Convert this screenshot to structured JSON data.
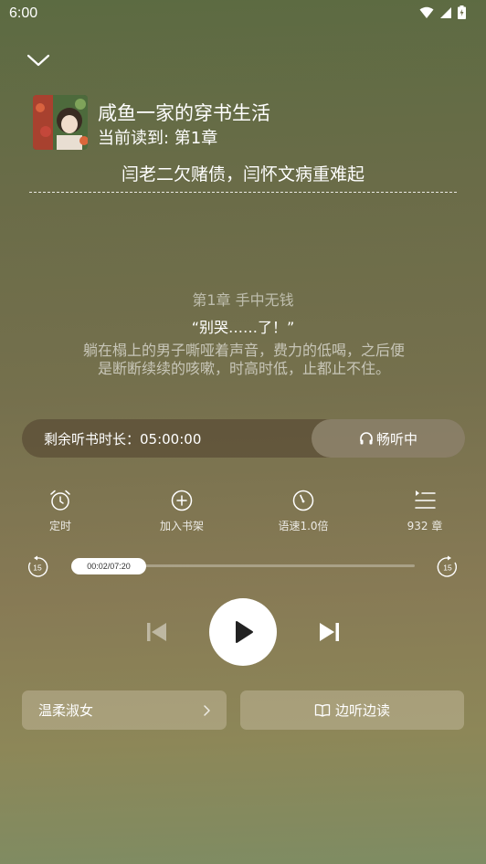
{
  "status_bar": {
    "time": "6:00"
  },
  "book": {
    "title": "咸鱼一家的穿书生活",
    "current_reading": "当前读到: 第1章",
    "chapter_heading": "闫老二欠赌债，闫怀文病重难起"
  },
  "preview": {
    "chapter": "第1章 手中无钱",
    "quote": "“别哭……了！”",
    "body": "躺在榻上的男子嘶哑着声音，费力的低喝，之后便是断断续续的咳嗽，时高时低，止都止不住。"
  },
  "remaining": {
    "label": "剩余听书时长：05:00:00",
    "listen_label": "畅听中"
  },
  "functions": [
    {
      "label": "定时",
      "icon": "alarm-clock-icon"
    },
    {
      "label": "加入书架",
      "icon": "add-circle-icon"
    },
    {
      "label": "语速1.0倍",
      "icon": "speedometer-icon"
    },
    {
      "label": "932 章",
      "icon": "chapter-list-icon"
    }
  ],
  "progress": {
    "time_label": "00:02/07:20",
    "fraction": 0.005,
    "skip_back_seconds": "15",
    "skip_forward_seconds": "15"
  },
  "bottom": {
    "voice_label": "温柔淑女",
    "read_along_label": "边听边读"
  }
}
